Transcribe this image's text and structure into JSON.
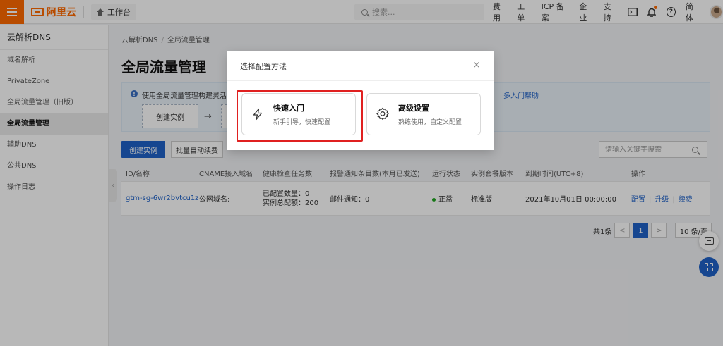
{
  "topbar": {
    "logo_text": "阿里云",
    "workbench_label": "工作台",
    "search_placeholder": "搜索...",
    "nav": [
      "费用",
      "工单",
      "ICP 备案",
      "企业",
      "支持"
    ],
    "lang_label": "简体",
    "accent_color": "#ff6a00",
    "icons": [
      "terminal-icon",
      "bell-icon",
      "help-icon"
    ]
  },
  "sidebar": {
    "title": "云解析DNS",
    "items": [
      "域名解析",
      "PrivateZone",
      "全局流量管理（旧版）",
      "全局流量管理",
      "辅助DNS",
      "公共DNS",
      "操作日志"
    ],
    "active_index": 3
  },
  "main": {
    "breadcrumb": [
      "云解析DNS",
      "全局流量管理"
    ],
    "title": "全局流量管理",
    "info_text": "使用全局流量管理构建灵活的D",
    "info_link": "多入门帮助",
    "step1": "创建实例",
    "create_button": "创建实例",
    "batch_button": "批量自动续费",
    "search_placeholder": "请输入关键字搜索",
    "table": {
      "headers": [
        "ID/名称",
        "CNAME接入域名",
        "健康检查任务数",
        "报警通知条目数(本月已发送)",
        "运行状态",
        "实例套餐版本",
        "到期时间(UTC+8)",
        "操作"
      ],
      "rows": [
        {
          "id": "gtm-sg-6wr2bvtcu1z",
          "cname": "公网域名:",
          "health_configured": "已配置数量：0",
          "health_total": "实例总配额：200",
          "alarm": "邮件通知：0",
          "status": "正常",
          "plan": "标准版",
          "expire": "2021年10月01日 00:00:00",
          "ops": [
            "配置",
            "升级",
            "续费"
          ]
        }
      ]
    },
    "pager": {
      "total": "共1条",
      "prev": "<",
      "current": "1",
      "next": ">",
      "size": "10 条/页"
    }
  },
  "modal": {
    "title": "选择配置方法",
    "close": "×",
    "options": [
      {
        "title": "快速入门",
        "desc": "新手引导，快速配置",
        "icon": "lightning-icon"
      },
      {
        "title": "高级设置",
        "desc": "熟练使用，自定义配置",
        "icon": "gear-icon"
      }
    ]
  },
  "colors": {
    "primary": "#1f62c8",
    "highlight": "#e02020",
    "status_ok": "#1fa51f"
  }
}
